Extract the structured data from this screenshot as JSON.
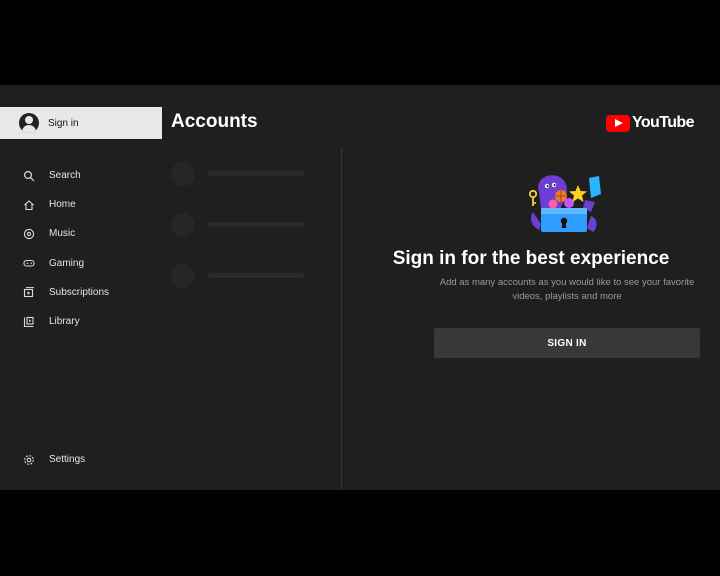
{
  "sidebar": {
    "signin_label": "Sign in",
    "items": [
      {
        "label": "Search",
        "icon": "search-icon"
      },
      {
        "label": "Home",
        "icon": "home-icon"
      },
      {
        "label": "Music",
        "icon": "music-icon"
      },
      {
        "label": "Gaming",
        "icon": "gaming-icon"
      },
      {
        "label": "Subscriptions",
        "icon": "subscriptions-icon"
      },
      {
        "label": "Library",
        "icon": "library-icon"
      }
    ],
    "settings_label": "Settings"
  },
  "header": {
    "title": "Accounts",
    "logo_text": "YouTube"
  },
  "main": {
    "heading": "Sign in for the best experience",
    "subtext": "Add as many accounts as you would like to see your favorite videos, playlists and more",
    "button_label": "SIGN IN"
  },
  "colors": {
    "background": "#1f1f1f",
    "brand_red": "#ff0000",
    "button": "#383838",
    "highlight": "#e8e8e8"
  }
}
